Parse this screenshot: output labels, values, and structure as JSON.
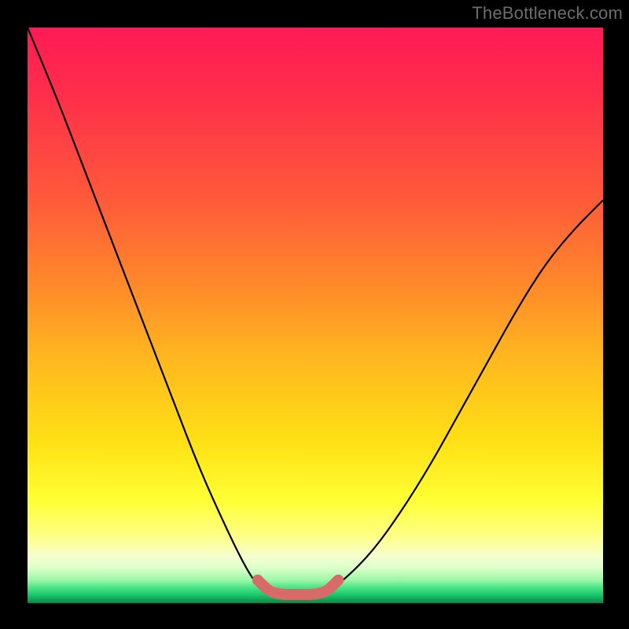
{
  "watermark": "TheBottleneck.com",
  "chart_data": {
    "type": "line",
    "title": "",
    "xlabel": "",
    "ylabel": "",
    "xlim": [
      0,
      100
    ],
    "ylim": [
      0,
      100
    ],
    "series": [
      {
        "name": "curve-left",
        "x": [
          0,
          5,
          10,
          15,
          20,
          25,
          30,
          35,
          38,
          40,
          42
        ],
        "y": [
          100,
          88,
          75,
          62,
          49,
          36,
          23,
          12,
          6,
          3,
          2
        ]
      },
      {
        "name": "curve-right",
        "x": [
          52,
          55,
          60,
          65,
          70,
          75,
          80,
          85,
          90,
          95,
          100
        ],
        "y": [
          2,
          4,
          9,
          16,
          24,
          33,
          42,
          51,
          59,
          65,
          70
        ]
      },
      {
        "name": "bridge-bottom",
        "x": [
          40,
          42,
          44,
          46,
          48,
          50,
          52,
          54
        ],
        "y": [
          4,
          2,
          1.5,
          1.5,
          1.5,
          1.5,
          2,
          4
        ]
      }
    ],
    "annotations": [
      {
        "type": "highlight",
        "series": "bridge-bottom",
        "color": "#d96a6a"
      }
    ]
  }
}
